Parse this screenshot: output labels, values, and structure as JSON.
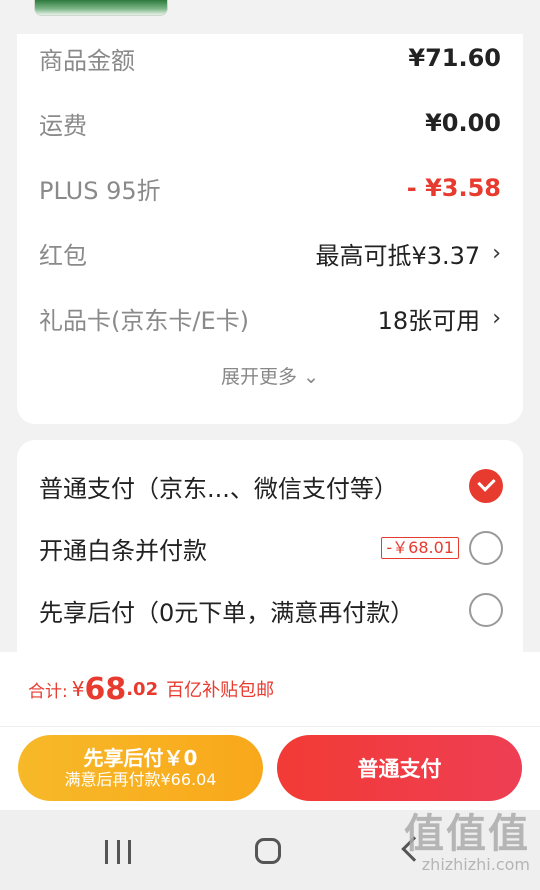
{
  "summary": {
    "rows": [
      {
        "label": "商品金额",
        "value": "¥71.60"
      },
      {
        "label": "运费",
        "value": "¥0.00"
      },
      {
        "label": "PLUS 95折",
        "value": "- ¥3.58"
      },
      {
        "label": "红包",
        "value": "最高可抵¥3.37"
      },
      {
        "label": "礼品卡(京东卡/E卡)",
        "value": "18张可用"
      }
    ],
    "expand_more": "展开更多",
    "expand_icon": "⌄"
  },
  "payment": {
    "options": [
      {
        "label": "普通支付（京东...、微信支付等）",
        "selected": true
      },
      {
        "label": "开通白条并付款",
        "discount": "-￥68.01",
        "selected": false
      },
      {
        "label": "先享后付（0元下单，满意再付款）",
        "selected": false
      }
    ]
  },
  "total": {
    "label": "合计:",
    "currency": "¥",
    "integer": "68",
    "decimal": ".02",
    "note": "百亿补贴包邮"
  },
  "actions": {
    "pay_later_title": "先享后付￥0",
    "pay_later_sub": "满意后再付款¥66.04",
    "pay_now": "普通支付"
  },
  "chevron": "›",
  "watermark": {
    "glyphs": "值值值",
    "url": "zhizhizhi.com"
  },
  "colors": {
    "accent": "#e83b2f",
    "later_button": "#f7b928"
  },
  "icons": [
    "chevron-right-icon",
    "check-icon",
    "radio-empty-icon",
    "nav-recent-icon",
    "nav-home-icon",
    "nav-back-icon"
  ]
}
